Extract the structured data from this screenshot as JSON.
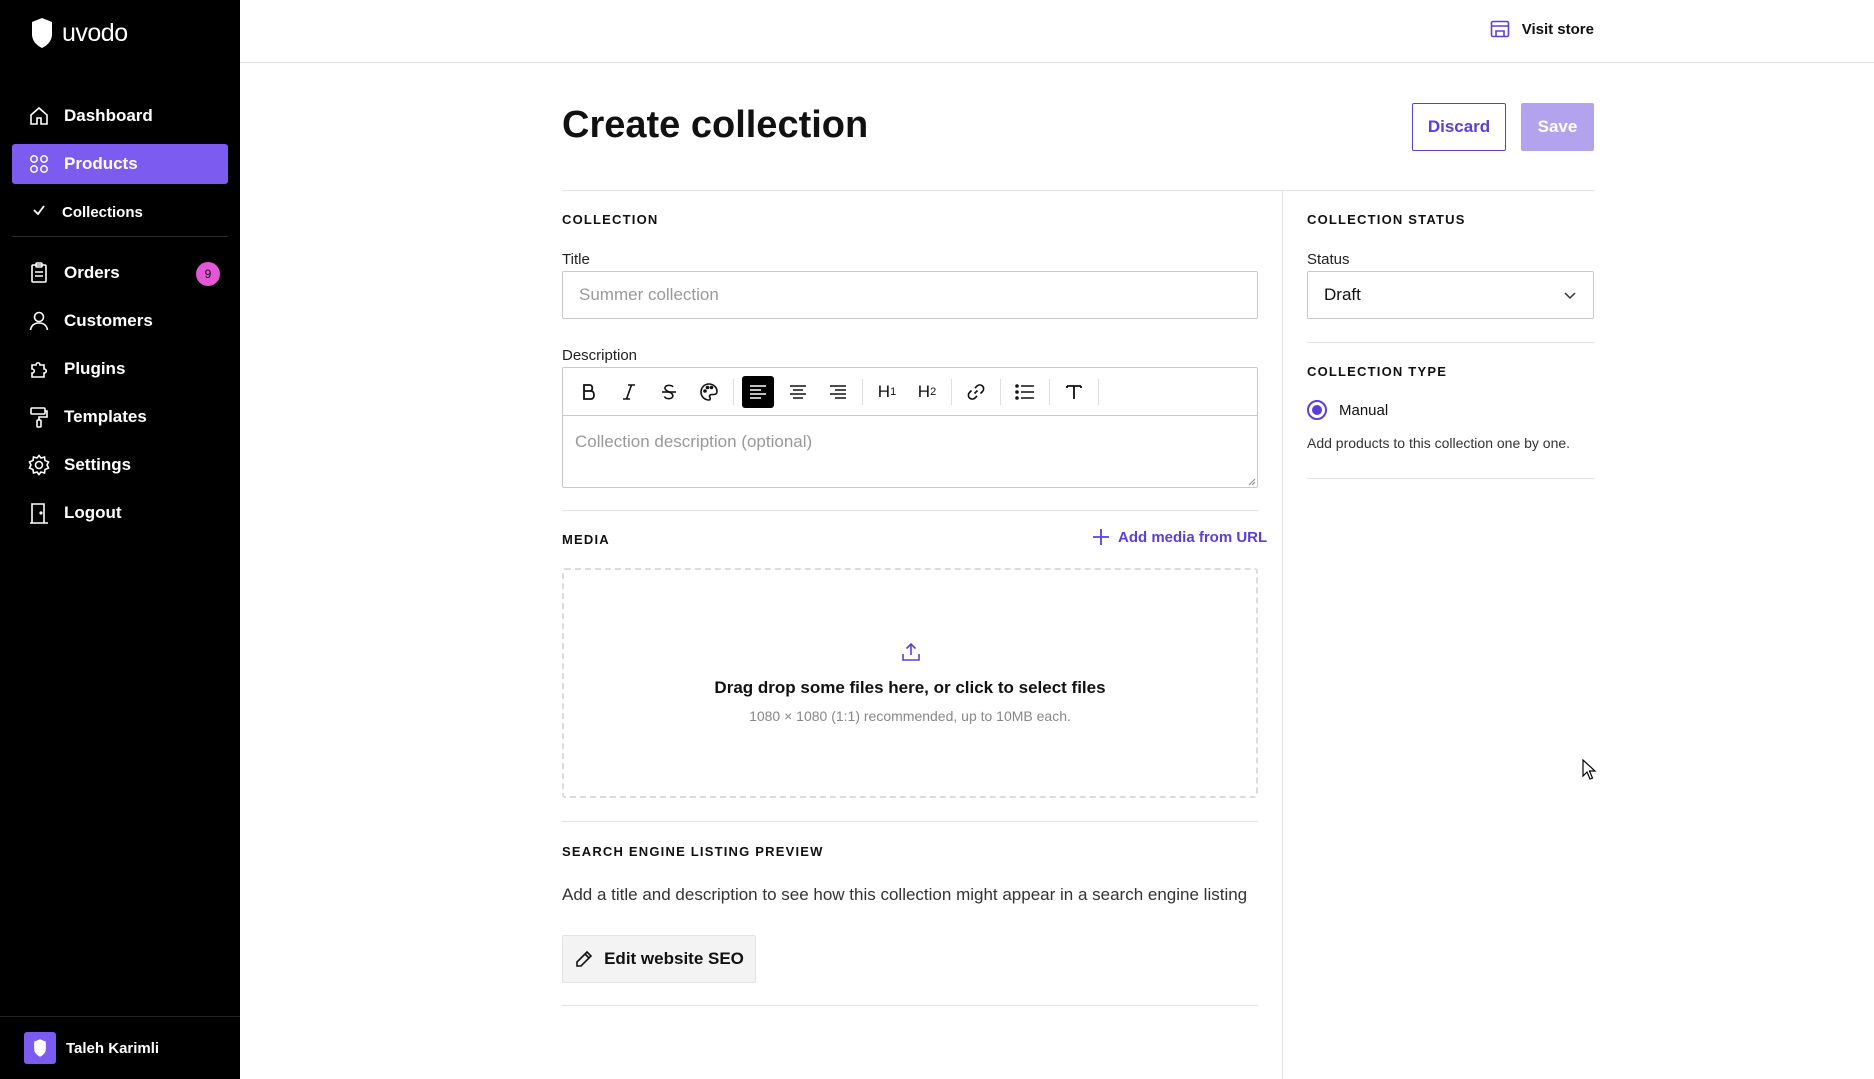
{
  "brand": {
    "name": "uvodo",
    "accent": "#7c5cf0"
  },
  "sidebar": {
    "items": [
      {
        "label": "Dashboard",
        "icon": "home-icon"
      },
      {
        "label": "Products",
        "icon": "grid-icon"
      },
      {
        "label": "Collections",
        "icon": "check-icon"
      },
      {
        "label": "Orders",
        "icon": "clipboard-icon",
        "badge": "9"
      },
      {
        "label": "Customers",
        "icon": "user-icon"
      },
      {
        "label": "Plugins",
        "icon": "puzzle-icon"
      },
      {
        "label": "Templates",
        "icon": "paint-roller-icon"
      },
      {
        "label": "Settings",
        "icon": "gear-icon"
      },
      {
        "label": "Logout",
        "icon": "door-icon"
      }
    ],
    "user": {
      "name": "Taleh Karimli"
    }
  },
  "topbar": {
    "visit_store": "Visit store"
  },
  "page": {
    "title": "Create collection",
    "discard": "Discard",
    "save": "Save"
  },
  "collection": {
    "section": "COLLECTION",
    "title_label": "Title",
    "title_placeholder": "Summer collection",
    "description_label": "Description",
    "description_placeholder": "Collection description (optional)",
    "toolbar": {
      "h1": "H",
      "h1_sub": "1",
      "h2": "H",
      "h2_sub": "2"
    }
  },
  "media": {
    "section": "MEDIA",
    "add_from_url": "Add media from URL",
    "drop_title": "Drag drop some files here, or click to select files",
    "drop_hint": "1080 × 1080 (1:1) recommended, up to 10MB each."
  },
  "seo": {
    "section": "SEARCH ENGINE LISTING PREVIEW",
    "text": "Add a title and description to see how this collection might appear in a search engine listing",
    "button": "Edit website SEO"
  },
  "status": {
    "section": "COLLECTION STATUS",
    "label": "Status",
    "value": "Draft"
  },
  "type": {
    "section": "COLLECTION TYPE",
    "option": "Manual",
    "help": "Add products to this collection one by one."
  }
}
